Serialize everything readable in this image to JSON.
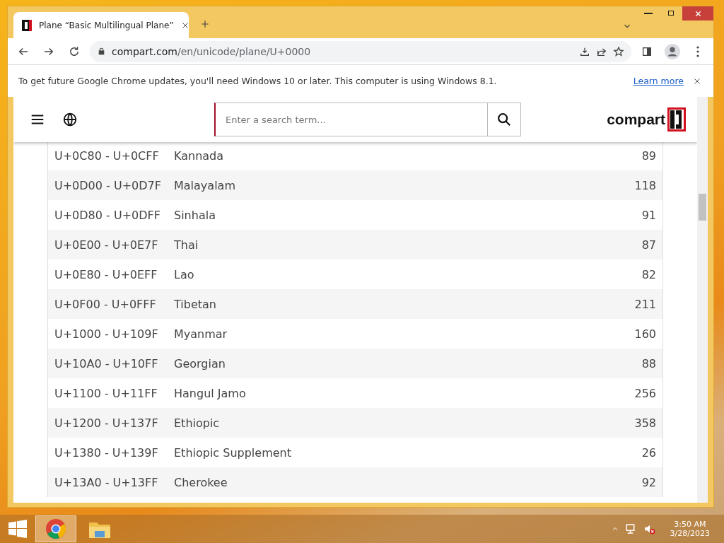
{
  "browser": {
    "tab": {
      "title": "Plane “Basic Multilingual Plane”",
      "selected": true
    },
    "address": {
      "domain": "compart.com",
      "path": "/en/unicode/plane/U+0000"
    },
    "infobar": {
      "message": "To get future Google Chrome updates, you'll need Windows 10 or later. This computer is using Windows 8.1.",
      "link": "Learn more"
    }
  },
  "site": {
    "search": {
      "placeholder": "Enter a search term..."
    },
    "logo": "compart"
  },
  "table": {
    "rows": [
      {
        "range": "U+0C80 - U+0CFF",
        "name": "Kannada",
        "count": "89"
      },
      {
        "range": "U+0D00 - U+0D7F",
        "name": "Malayalam",
        "count": "118"
      },
      {
        "range": "U+0D80 - U+0DFF",
        "name": "Sinhala",
        "count": "91"
      },
      {
        "range": "U+0E00 - U+0E7F",
        "name": "Thai",
        "count": "87"
      },
      {
        "range": "U+0E80 - U+0EFF",
        "name": "Lao",
        "count": "82"
      },
      {
        "range": "U+0F00 - U+0FFF",
        "name": "Tibetan",
        "count": "211"
      },
      {
        "range": "U+1000 - U+109F",
        "name": "Myanmar",
        "count": "160"
      },
      {
        "range": "U+10A0 - U+10FF",
        "name": "Georgian",
        "count": "88"
      },
      {
        "range": "U+1100 - U+11FF",
        "name": "Hangul Jamo",
        "count": "256"
      },
      {
        "range": "U+1200 - U+137F",
        "name": "Ethiopic",
        "count": "358"
      },
      {
        "range": "U+1380 - U+139F",
        "name": "Ethiopic Supplement",
        "count": "26"
      },
      {
        "range": "U+13A0 - U+13FF",
        "name": "Cherokee",
        "count": "92"
      }
    ]
  },
  "taskbar": {
    "apps": [
      {
        "kind": "browser",
        "selected": true
      },
      {
        "kind": "files",
        "selected": false
      }
    ],
    "time": "3:50 AM",
    "date": "3/28/2023"
  }
}
